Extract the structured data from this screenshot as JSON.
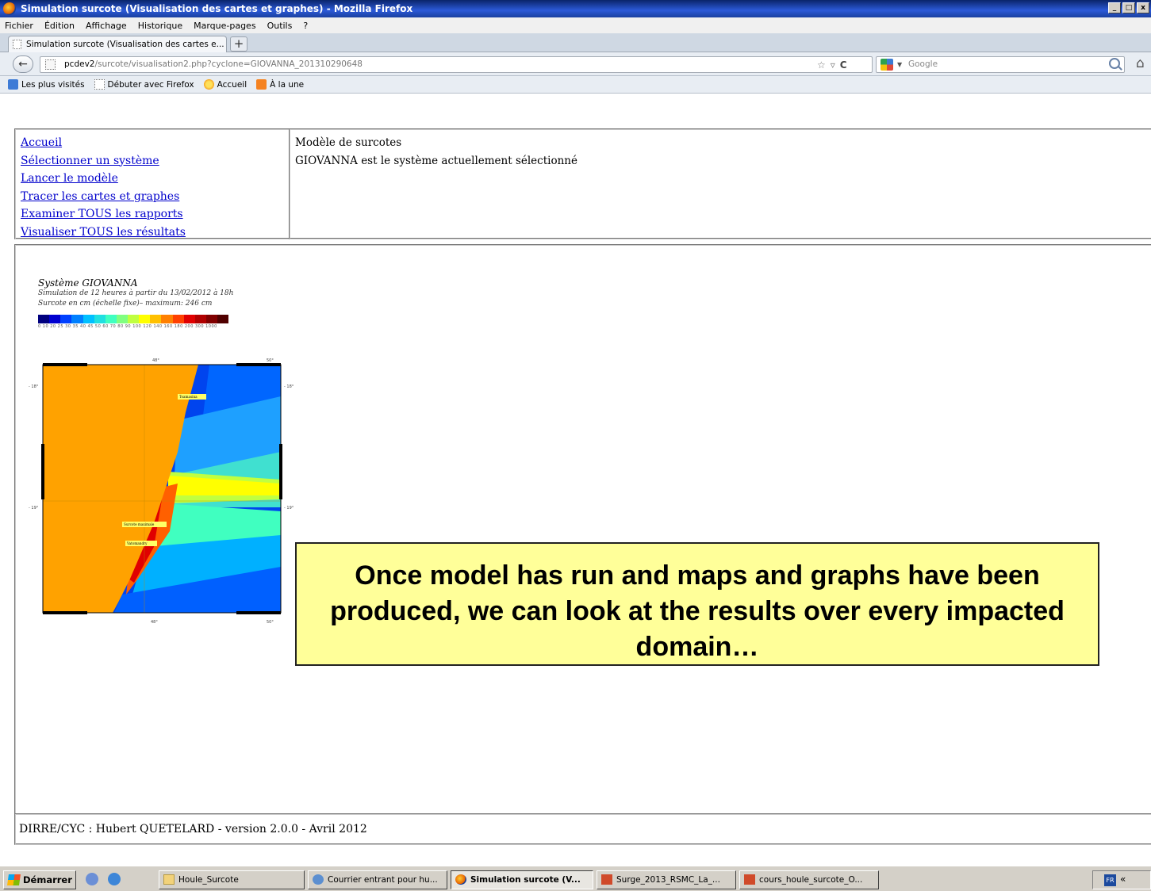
{
  "window": {
    "title": "Simulation surcote (Visualisation des cartes et graphes) - Mozilla Firefox",
    "buttons": [
      "_",
      "□",
      "x"
    ]
  },
  "menu": [
    "Fichier",
    "Édition",
    "Affichage",
    "Historique",
    "Marque-pages",
    "Outils",
    "?"
  ],
  "tab": {
    "title": "Simulation surcote (Visualisation des cartes e...",
    "new_tab_label": "+"
  },
  "url": {
    "host": "pcdev2",
    "path": "/surcote/visualisation2.php?cyclone=GIOVANNA_201310290648"
  },
  "search": {
    "placeholder": "Google"
  },
  "bookmarks": [
    "Les plus visités",
    "Débuter avec Firefox",
    "Accueil",
    "À la une"
  ],
  "nav_links": [
    "Accueil",
    "Sélectionner un système",
    "Lancer le modèle",
    "Tracer les cartes et graphes",
    "Examiner TOUS les rapports",
    "Visualiser TOUS les résultats"
  ],
  "info": {
    "line1": "Modèle de surcotes",
    "line2": "GIOVANNA est le système actuellement sélectionné"
  },
  "figure": {
    "title": "Système GIOVANNA",
    "subtitle1": "Simulation de 12  heures à partir du 13/02/2012 à 18h",
    "subtitle2": "Surcote en cm (échelle fixe)– maximum: 246 cm",
    "colorbar_ticks": "0  10  20  25  30  35  40  45  50  60  70  80  90  100 120 140 160 180 200 300 1000",
    "colors": [
      "#00007f",
      "#0000d0",
      "#0040ff",
      "#0080ff",
      "#00c0ff",
      "#20e0e0",
      "#40ffc0",
      "#80ff80",
      "#c0ff40",
      "#ffff00",
      "#ffc000",
      "#ff8000",
      "#ff4000",
      "#e00000",
      "#b00000",
      "#800000",
      "#500000"
    ],
    "labels": {
      "tamatave": "Toamasina",
      "max": "Surcote maximale",
      "vato": "Vatomandry"
    },
    "lat_labels": [
      "- 18°",
      "- 19°",
      "- 18°",
      "- 19°"
    ],
    "lon_labels": [
      "48°",
      "50°",
      "48°",
      "50°"
    ]
  },
  "callout": {
    "text": "Once model has run and maps and graphs have been produced, we can look at the results over every impacted domain…"
  },
  "footer": {
    "text": "DIRRE/CYC : Hubert QUETELARD - version 2.0.0 - Avril 2012"
  },
  "taskbar": {
    "start": "Démarrer",
    "items": [
      "Houle_Surcote",
      "Courrier entrant pour hu...",
      "Simulation surcote (V...",
      "Surge_2013_RSMC_La_...",
      "cours_houle_surcote_O..."
    ],
    "lang": "FR",
    "chevron": "«"
  }
}
